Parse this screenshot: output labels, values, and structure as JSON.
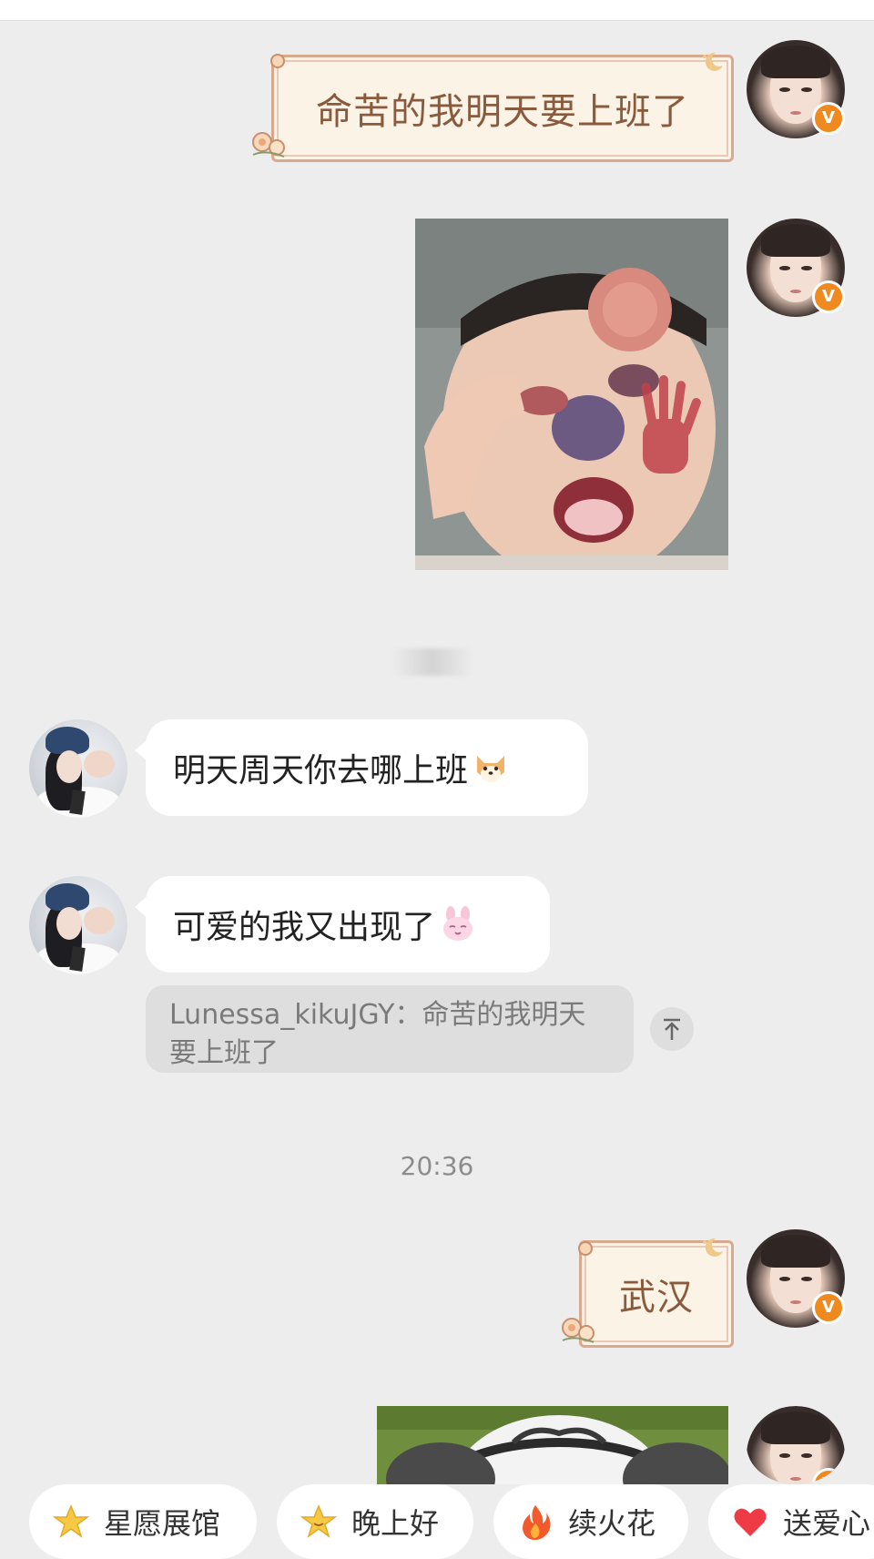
{
  "messages": {
    "m1_text": "命苦的我明天要上班了",
    "m5_text": "明天周天你去哪上班",
    "m6_text": "可爱的我又出现了",
    "m6_quote": "Lunessa_kikuJGY：命苦的我明天要上班了",
    "timestamp": "20:36",
    "m7_text": "武汉"
  },
  "badges": {
    "verified": "V"
  },
  "quick_replies": [
    {
      "label": "星愿展馆",
      "icon": "star-icon"
    },
    {
      "label": "晚上好",
      "icon": "smiling-star-icon"
    },
    {
      "label": "续火花",
      "icon": "fire-icon"
    },
    {
      "label": "送爱心",
      "icon": "heart-icon"
    }
  ],
  "colors": {
    "background": "#ededed",
    "fancy_text": "#8a5a3c",
    "verified_badge": "#f08a1f",
    "bubble": "#ffffff",
    "quote": "#dedede"
  }
}
